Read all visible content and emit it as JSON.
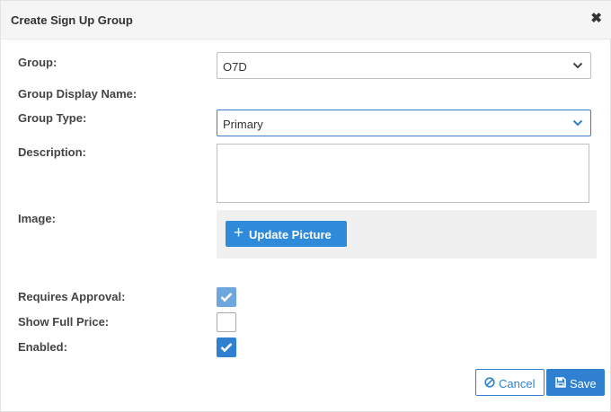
{
  "dialog": {
    "title": "Create Sign Up Group",
    "close_glyph": "✖"
  },
  "form": {
    "group_label": "Group:",
    "group_value": "O7D",
    "group_display_name_label": "Group Display Name:",
    "group_type_label": "Group Type:",
    "group_type_value": "Primary",
    "description_label": "Description:",
    "description_value": "",
    "image_label": "Image:",
    "update_picture_label": "Update Picture",
    "requires_approval_label": "Requires Approval:",
    "requires_approval_checked": true,
    "show_full_price_label": "Show Full Price:",
    "show_full_price_checked": false,
    "enabled_label": "Enabled:",
    "enabled_checked": true
  },
  "footer": {
    "cancel_label": "Cancel",
    "save_label": "Save"
  },
  "icons": {
    "close": "close-icon",
    "chevron": "chevron-down-icon",
    "plus": "plus-icon",
    "check": "check-icon",
    "cancel": "ban-icon",
    "save": "floppy-disk-icon"
  },
  "colors": {
    "primary": "#2f80d1",
    "header_bg": "#f5f5f5",
    "image_panel_bg": "#f0f0f0"
  }
}
